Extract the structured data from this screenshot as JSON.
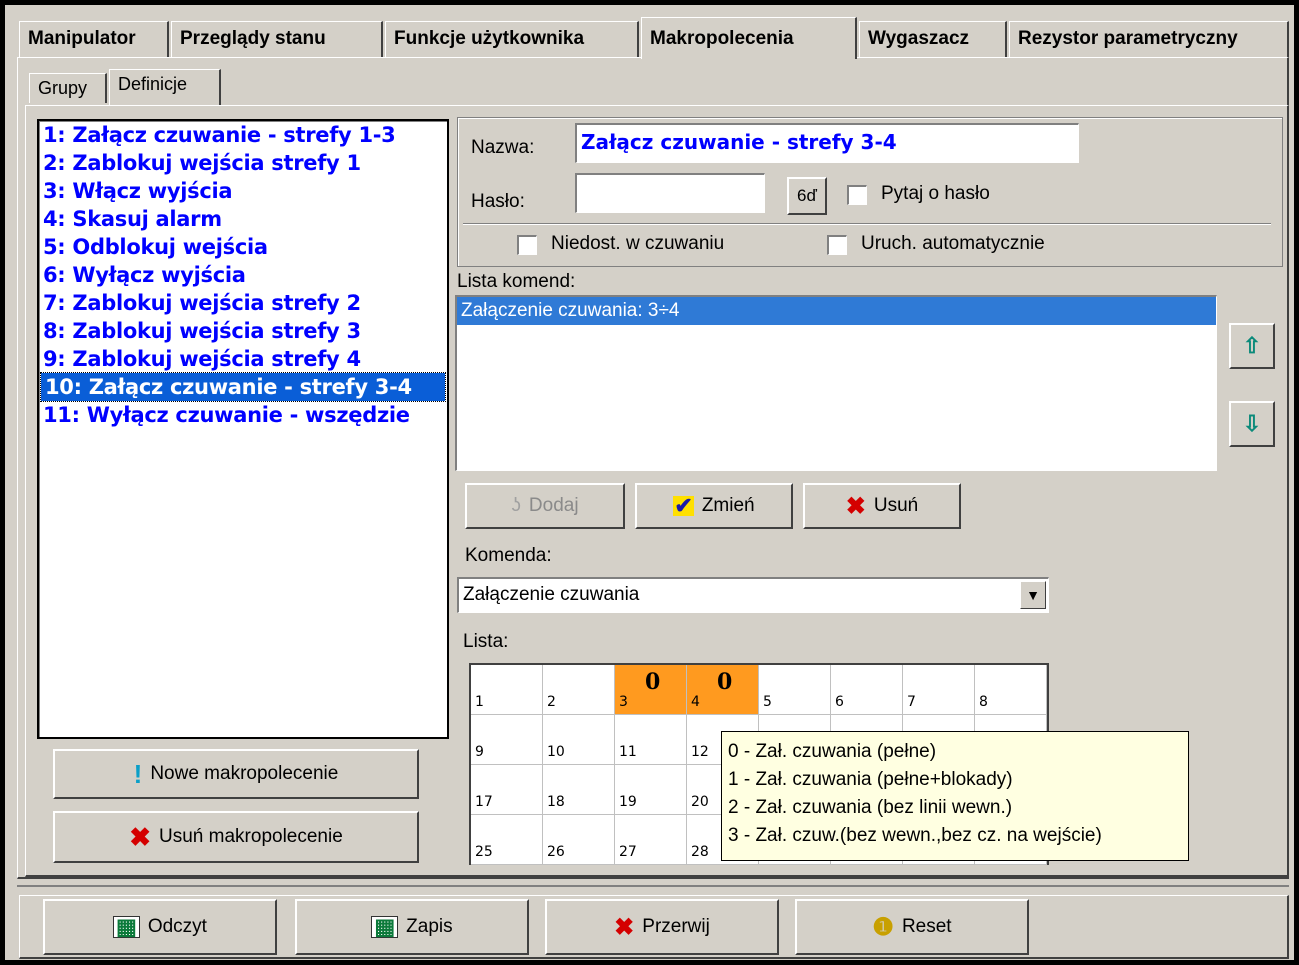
{
  "tabs": [
    {
      "label": "Manipulator"
    },
    {
      "label": "Przeglądy stanu"
    },
    {
      "label": "Funkcje użytkownika"
    },
    {
      "label": "Makropolecenia"
    },
    {
      "label": "Wygaszacz"
    },
    {
      "label": "Rezystor parametryczny"
    }
  ],
  "subtabs": [
    {
      "label": "Grupy"
    },
    {
      "label": "Definicje"
    }
  ],
  "macros": [
    {
      "label": "1: Załącz czuwanie - strefy 1-3"
    },
    {
      "label": "2: Zablokuj wejścia strefy 1"
    },
    {
      "label": "3: Włącz wyjścia"
    },
    {
      "label": "4: Skasuj alarm"
    },
    {
      "label": "5: Odblokuj wejścia"
    },
    {
      "label": "6: Wyłącz wyjścia"
    },
    {
      "label": "7: Zablokuj wejścia strefy 2"
    },
    {
      "label": "8: Zablokuj wejścia strefy 3"
    },
    {
      "label": "9: Zablokuj wejścia strefy 4"
    },
    {
      "label": "10: Załącz czuwanie - strefy 3-4"
    },
    {
      "label": "11: Wyłącz czuwanie - wszędzie"
    }
  ],
  "macro_buttons": {
    "new_label": "Nowe makropolecenie",
    "delete_label": "Usuń makropolecenie"
  },
  "form": {
    "name_label": "Nazwa:",
    "name_value": "Załącz czuwanie - strefy 3-4",
    "password_label": "Hasło:",
    "password_value": "",
    "show_password_label": "6ď",
    "ask_password_label": "Pytaj o hasło",
    "unavailable_label": "Niedost. w czuwaniu",
    "autorun_label": "Uruch. automatycznie"
  },
  "commands": {
    "label": "Lista komend:",
    "items": [
      "Załączenie czuwania: 3÷4"
    ]
  },
  "command_buttons": {
    "add_label": "Dodaj",
    "change_label": "Zmień",
    "delete_label": "Usuń"
  },
  "command_select": {
    "label": "Komenda:",
    "value": "Załączenie czuwania"
  },
  "list": {
    "label": "Lista:",
    "cells": [
      {
        "n": "1",
        "v": ""
      },
      {
        "n": "2",
        "v": ""
      },
      {
        "n": "3",
        "v": "0"
      },
      {
        "n": "4",
        "v": "0"
      },
      {
        "n": "5",
        "v": ""
      },
      {
        "n": "6",
        "v": ""
      },
      {
        "n": "7",
        "v": ""
      },
      {
        "n": "8",
        "v": ""
      },
      {
        "n": "9",
        "v": ""
      },
      {
        "n": "10",
        "v": ""
      },
      {
        "n": "11",
        "v": ""
      },
      {
        "n": "12",
        "v": ""
      },
      {
        "n": "17",
        "v": ""
      },
      {
        "n": "18",
        "v": ""
      },
      {
        "n": "19",
        "v": ""
      },
      {
        "n": "20",
        "v": ""
      },
      {
        "n": "25",
        "v": ""
      },
      {
        "n": "26",
        "v": ""
      },
      {
        "n": "27",
        "v": ""
      },
      {
        "n": "28",
        "v": ""
      }
    ],
    "hot_color": "#ff9a1f"
  },
  "tooltip": {
    "lines": [
      "0 - Zał. czuwania (pełne)",
      "1 - Zał. czuwania (pełne+blokady)",
      "2 - Zał. czuwania (bez linii wewn.)",
      "3 - Zał. czuw.(bez wewn.,bez cz. na wejście)"
    ]
  },
  "footer": {
    "read_label": "Odczyt",
    "write_label": "Zapis",
    "abort_label": "Przerwij",
    "reset_label": "Reset"
  }
}
